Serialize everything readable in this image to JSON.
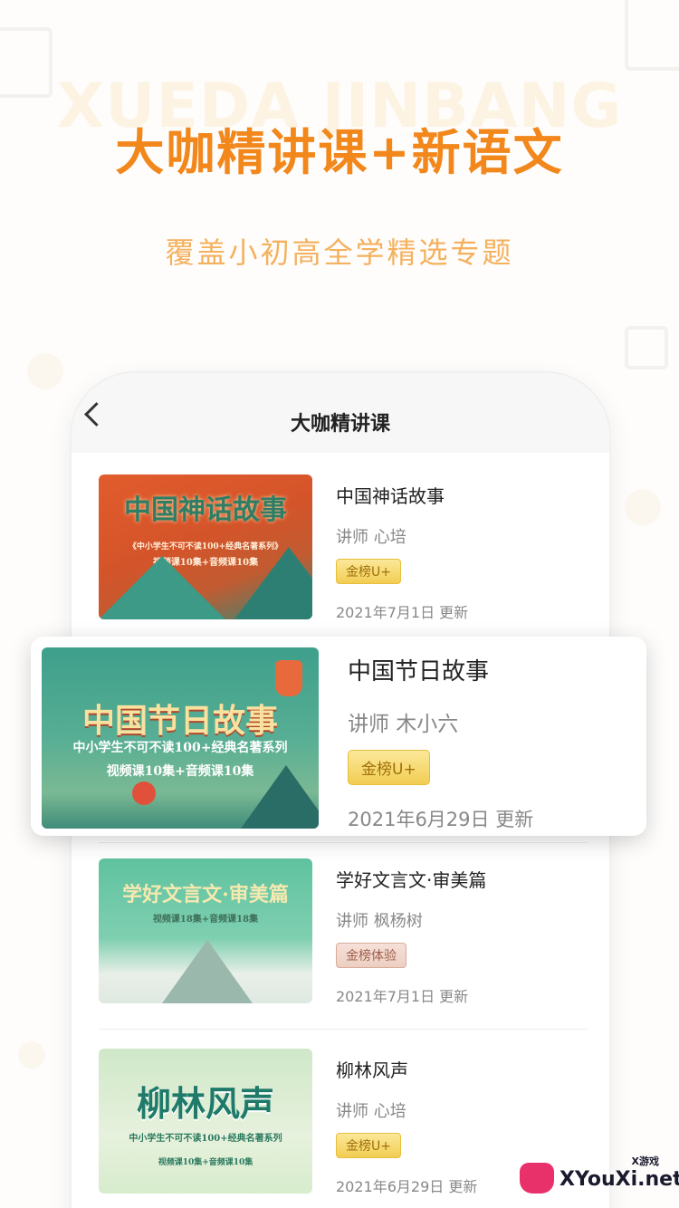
{
  "hero": {
    "watermark": "XUEDA JINBANG",
    "title": "大咖精讲课+新语文",
    "subtitle": "覆盖小初高全学精选专题"
  },
  "nav": {
    "title": "大咖精讲课"
  },
  "courses": [
    {
      "name": "中国神话故事",
      "teacher": "讲师 心培",
      "badge": "金榜U+",
      "date": "2021年7月1日 更新",
      "thumb_title": "中国神话故事",
      "thumb_sub1": "《中小学生不可不读100+经典名著系列》",
      "thumb_sub2": "视频课10集+音频课10集"
    },
    {
      "name": "中国节日故事",
      "teacher": "讲师 木小六",
      "badge": "金榜U+",
      "date": "2021年6月29日 更新",
      "thumb_title": "中国节日故事",
      "thumb_sub1": "中小学生不可不读100+经典名著系列",
      "thumb_sub2": "视频课10集+音频课10集"
    },
    {
      "name": "学好文言文·审美篇",
      "teacher": "讲师 枫杨树",
      "badge": "金榜体验",
      "date": "2021年7月1日 更新",
      "thumb_title": "学好文言文·审美篇",
      "thumb_sub1": "视频课18集+音频课18集"
    },
    {
      "name": "柳林风声",
      "teacher": "讲师 心培",
      "badge": "金榜U+",
      "date": "2021年6月29日 更新",
      "thumb_title": "柳林风声",
      "thumb_sub1": "中小学生不可不读100+经典名著系列",
      "thumb_sub2": "视频课10集+音频课10集"
    }
  ],
  "logo": {
    "text": "XYouXi.net",
    "small": "X游戏"
  },
  "colors": {
    "accent": "#f2871c",
    "subtitle": "#f4b15e",
    "badge_gold": "#f2cd53",
    "badge_trial": "#eccfc2"
  }
}
